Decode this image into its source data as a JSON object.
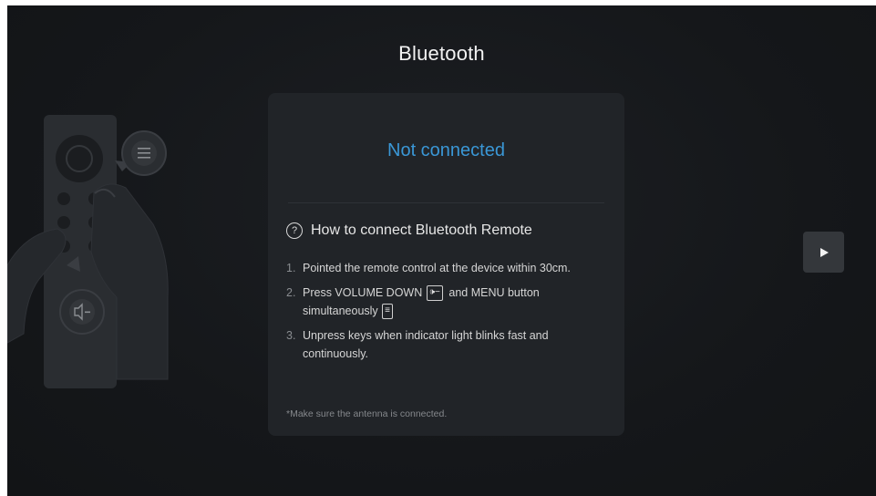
{
  "page_title": "Bluetooth",
  "status": "Not connected",
  "howto": {
    "title": "How to connect Bluetooth Remote",
    "help_icon": "?"
  },
  "steps": [
    {
      "num": "1.",
      "text": "Pointed the remote control at the device within 30cm."
    },
    {
      "num": "2.",
      "text_a": "Press VOLUME DOWN",
      "key_volume": "🕩−",
      "text_b": "and MENU button simultaneously",
      "key_menu": "≡"
    },
    {
      "num": "3.",
      "text": "Unpress keys when indicator light blinks fast and continuously."
    }
  ],
  "note": "*Make sure the antenna is connected.",
  "next_button_icon": "play-icon",
  "colors": {
    "accent": "#3a97d6",
    "background": "#15171a",
    "card": "#212428"
  }
}
